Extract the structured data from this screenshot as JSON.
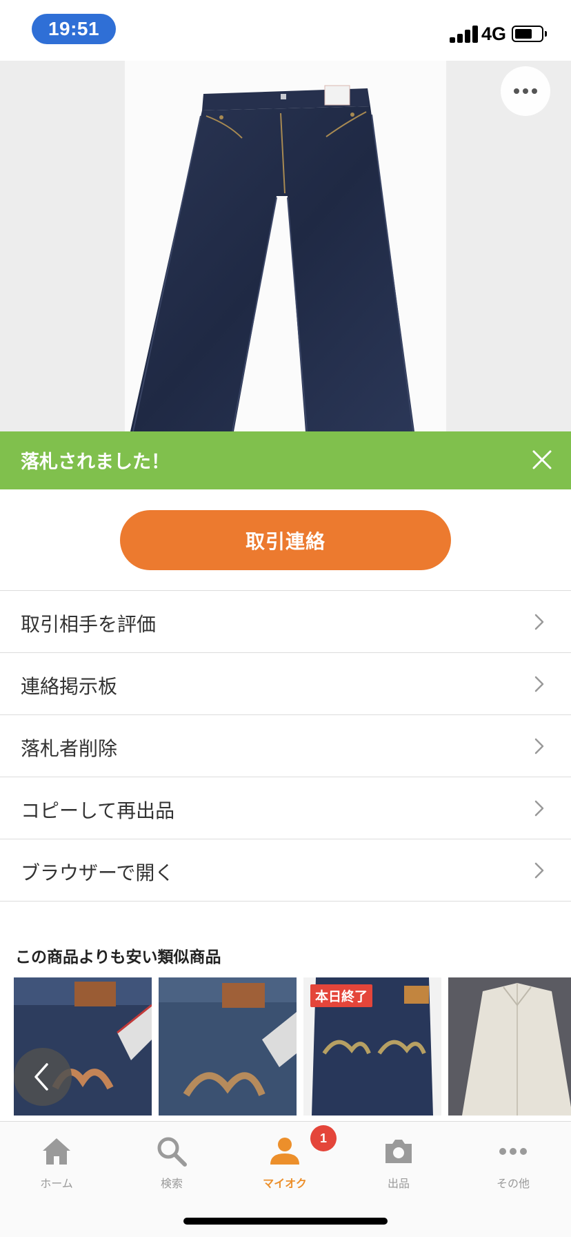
{
  "status_bar": {
    "time": "19:51",
    "network": "4G",
    "battery_level": 0.6
  },
  "product": {
    "image": "jeans-photo"
  },
  "banner": {
    "text": "落札されました！",
    "close_icon": "close-icon"
  },
  "primary_action": {
    "label": "取引連絡"
  },
  "menu": {
    "items": [
      {
        "label": "取引相手を評価"
      },
      {
        "label": "連絡掲示板"
      },
      {
        "label": "落札者削除"
      },
      {
        "label": "コピーして再出品"
      },
      {
        "label": "ブラウザーで開く"
      }
    ]
  },
  "similar": {
    "title": "この商品よりも安い類似商品",
    "items": [
      {
        "image": "jeans-back-selvedge-photo",
        "badge": ""
      },
      {
        "image": "jeans-back-pocket-photo",
        "badge": ""
      },
      {
        "image": "jeans-back-photo",
        "badge": "本日終了"
      },
      {
        "image": "light-jacket-photo",
        "badge": ""
      }
    ]
  },
  "tabbar": {
    "tabs": [
      {
        "label": "ホーム",
        "icon": "home-icon",
        "active": false
      },
      {
        "label": "検索",
        "icon": "search-icon",
        "active": false
      },
      {
        "label": "マイオク",
        "icon": "user-icon",
        "active": true
      },
      {
        "label": "出品",
        "icon": "camera-icon",
        "active": false
      },
      {
        "label": "その他",
        "icon": "more-icon",
        "active": false
      }
    ],
    "notification_count": "1"
  },
  "colors": {
    "accent": "#ec7a2f",
    "banner_green": "#80c04d",
    "time_pill": "#2f6fd6",
    "badge_red": "#e4453a",
    "active_tab": "#ec8f2b"
  }
}
